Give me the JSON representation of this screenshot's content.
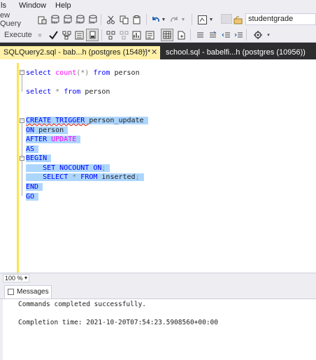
{
  "menu": {
    "items": [
      "ls",
      "Window",
      "Help"
    ]
  },
  "toolbar1": {
    "new_query": "ew Query",
    "database": "studentgrade"
  },
  "toolbar2": {
    "execute": "Execute"
  },
  "tabs": {
    "active": "SQLQuery2.sql - bab...h (postgres (1548))*",
    "other": "school.sql - babelfi...h (postgres (10956))"
  },
  "editor": {
    "lines": [
      "select count(*) from person",
      "select * from person",
      "CREATE TRIGGER person_update",
      "ON person",
      "AFTER UPDATE",
      "AS",
      "BEGIN",
      "SET NOCOUNT ON;",
      "SELECT * FROM inserted;",
      "END",
      "GO"
    ]
  },
  "zoom": "100 %",
  "results": {
    "tab": "Messages",
    "line1": "Commands completed successfully.",
    "line2": "Completion time: 2021-10-20T07:54:23.5908560+00:00"
  }
}
